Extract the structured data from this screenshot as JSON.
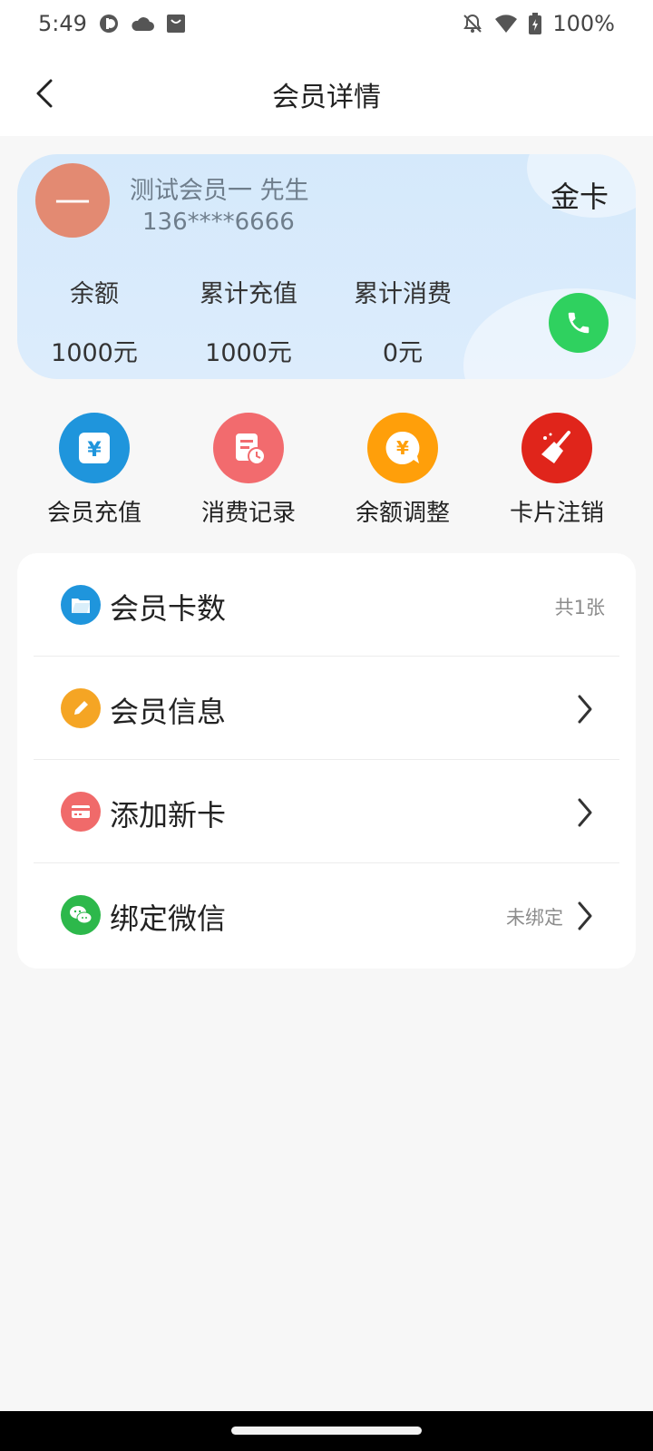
{
  "status_bar": {
    "time": "5:49",
    "battery": "100%",
    "left_icons": [
      "app-icon",
      "cloud-icon",
      "shopping-bag-icon"
    ],
    "right_icons": [
      "bell-off-icon",
      "wifi-icon",
      "battery-icon"
    ]
  },
  "header": {
    "title": "会员详情",
    "back_icon": "chevron-left-icon"
  },
  "member_card": {
    "avatar_text": "—",
    "name": "测试会员一 先生",
    "phone": "136****6666",
    "level": "金卡",
    "stats": [
      {
        "label": "余额",
        "value": "1000元"
      },
      {
        "label": "累计充值",
        "value": "1000元"
      },
      {
        "label": "累计消费",
        "value": "0元"
      }
    ],
    "call_icon": "phone-icon",
    "colors": {
      "card_bg": "#d5e9fb",
      "avatar": "#e38a72",
      "call": "#2fd15f"
    }
  },
  "actions": [
    {
      "label": "会员充值",
      "icon": "yuan-card-icon",
      "color": "#1f95dc"
    },
    {
      "label": "消费记录",
      "icon": "record-clock-icon",
      "color": "#f26b6e"
    },
    {
      "label": "余额调整",
      "icon": "yuan-bubble-icon",
      "color": "#ff9f0a"
    },
    {
      "label": "卡片注销",
      "icon": "broom-icon",
      "color": "#e0251b"
    }
  ],
  "menu": [
    {
      "label": "会员卡数",
      "value": "共1张",
      "icon": "folder-icon",
      "color": "#1f95dc",
      "chevron": false
    },
    {
      "label": "会员信息",
      "value": "",
      "icon": "pencil-icon",
      "color": "#f5a524",
      "chevron": true
    },
    {
      "label": "添加新卡",
      "value": "",
      "icon": "card-icon",
      "color": "#f06a6a",
      "chevron": true
    },
    {
      "label": "绑定微信",
      "value": "未绑定",
      "icon": "wechat-icon",
      "color": "#2db84b",
      "chevron": true
    }
  ]
}
